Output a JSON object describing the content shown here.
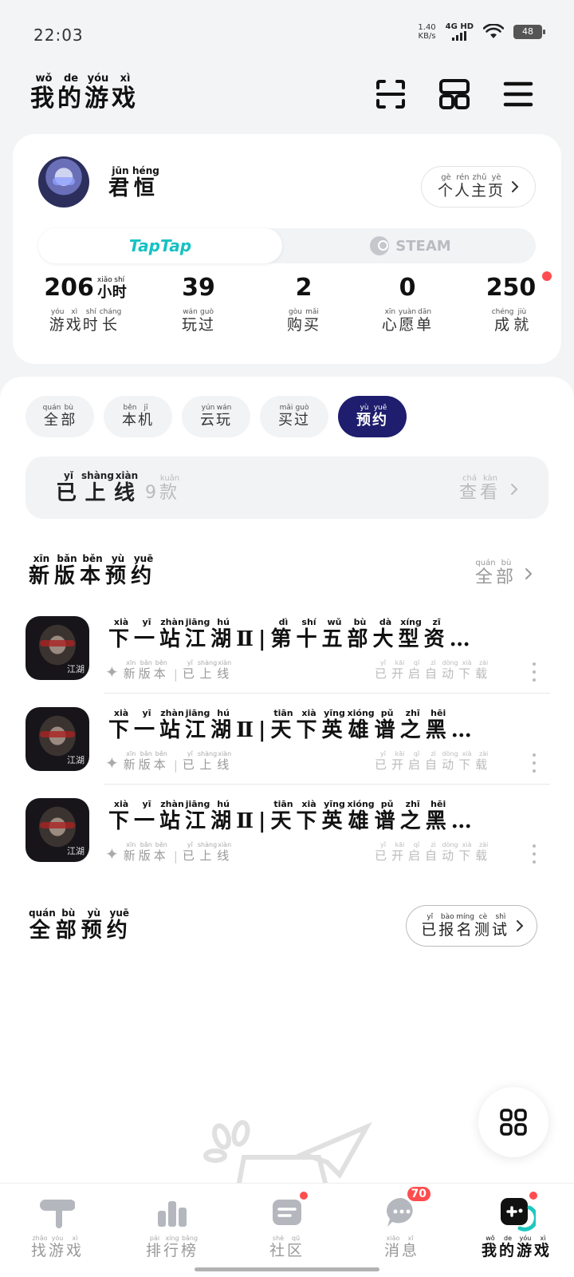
{
  "status_bar": {
    "time": "22:03",
    "net_speed_value": "1.40",
    "net_speed_unit": "KB/s",
    "network": "4G HD",
    "battery": "48"
  },
  "header": {
    "title": [
      "我",
      "的",
      "游",
      "戏"
    ],
    "title_pinyin": [
      "wǒ",
      "de",
      "yóu",
      "xì"
    ],
    "icons": [
      "scan-icon",
      "layout-grid-icon",
      "menu-icon"
    ]
  },
  "profile": {
    "name": [
      "君",
      "恒"
    ],
    "name_pinyin": [
      "jūn",
      "héng"
    ],
    "homepage": [
      "个",
      "人",
      "主",
      "页"
    ],
    "homepage_pinyin": [
      "gè",
      "rén",
      "zhǔ",
      "yè"
    ],
    "platforms": {
      "active": "TapTap",
      "inactive": "STEAM"
    },
    "stats": [
      {
        "value": "206",
        "unit": [
          "小",
          "时"
        ],
        "unit_pinyin": [
          "xiǎo",
          "shí"
        ],
        "label": [
          "游",
          "戏",
          "时",
          "长"
        ],
        "label_pinyin": [
          "yóu",
          "xì",
          "shí",
          "cháng"
        ]
      },
      {
        "value": "39",
        "label": [
          "玩",
          "过"
        ],
        "label_pinyin": [
          "wán",
          "guò"
        ]
      },
      {
        "value": "2",
        "label": [
          "购",
          "买"
        ],
        "label_pinyin": [
          "gòu",
          "mǎi"
        ]
      },
      {
        "value": "0",
        "label": [
          "心",
          "愿",
          "单"
        ],
        "label_pinyin": [
          "xīn",
          "yuàn",
          "dān"
        ]
      },
      {
        "value": "250",
        "label": [
          "成",
          "就"
        ],
        "label_pinyin": [
          "chéng",
          "jiù"
        ],
        "has_dot": true
      }
    ]
  },
  "filters": [
    {
      "label": [
        "全",
        "部"
      ],
      "pinyin": [
        "quán",
        "bù"
      ],
      "active": false
    },
    {
      "label": [
        "本",
        "机"
      ],
      "pinyin": [
        "běn",
        "jī"
      ],
      "active": false
    },
    {
      "label": [
        "云",
        "玩"
      ],
      "pinyin": [
        "yún",
        "wán"
      ],
      "active": false
    },
    {
      "label": [
        "买",
        "过"
      ],
      "pinyin": [
        "mǎi",
        "guò"
      ],
      "active": false
    },
    {
      "label": [
        "预",
        "约"
      ],
      "pinyin": [
        "yù",
        "yuē"
      ],
      "active": true
    }
  ],
  "online": {
    "label": [
      "已",
      "上",
      "线"
    ],
    "label_pinyin": [
      "yǐ",
      "shàng",
      "xiàn"
    ],
    "count": [
      "9",
      "款"
    ],
    "count_pinyin": [
      "",
      "kuǎn"
    ],
    "view": [
      "查",
      "看"
    ],
    "view_pinyin": [
      "chá",
      "kàn"
    ]
  },
  "new_version_section": {
    "title": [
      "新",
      "版",
      "本",
      "预",
      "约"
    ],
    "title_pinyin": [
      "xīn",
      "bǎn",
      "běn",
      "yù",
      "yuē"
    ],
    "all": [
      "全",
      "部"
    ],
    "all_pinyin": [
      "quán",
      "bù"
    ]
  },
  "games": [
    {
      "title_chars": [
        "下",
        "一",
        "站",
        "江",
        "湖",
        "Ⅱ",
        "|",
        "第",
        "十",
        "五",
        "部",
        "大",
        "型",
        "资",
        "…"
      ],
      "title_pinyin": [
        "xià",
        "yī",
        "zhàn",
        "jiāng",
        "hú",
        "",
        "",
        "dì",
        "shí",
        "wǔ",
        "bù",
        "dà",
        "xíng",
        "zī",
        ""
      ],
      "tag": [
        "新",
        "版",
        "本"
      ],
      "tag_pinyin": [
        "xīn",
        "bǎn",
        "běn"
      ],
      "status": [
        "已",
        "上",
        "线"
      ],
      "status_pinyin": [
        "yǐ",
        "shàng",
        "xiàn"
      ],
      "extra": [
        "已",
        "开",
        "启",
        "自",
        "动",
        "下",
        "载"
      ],
      "extra_pinyin": [
        "yǐ",
        "kāi",
        "qǐ",
        "zì",
        "dòng",
        "xià",
        "zài"
      ],
      "icon_text": "江湖"
    },
    {
      "title_chars": [
        "下",
        "一",
        "站",
        "江",
        "湖",
        "Ⅱ",
        "|",
        "天",
        "下",
        "英",
        "雄",
        "谱",
        "之",
        "黑",
        "…"
      ],
      "title_pinyin": [
        "xià",
        "yī",
        "zhàn",
        "jiāng",
        "hú",
        "",
        "",
        "tiān",
        "xià",
        "yīng",
        "xióng",
        "pǔ",
        "zhī",
        "hēi",
        ""
      ],
      "tag": [
        "新",
        "版",
        "本"
      ],
      "tag_pinyin": [
        "xīn",
        "bǎn",
        "běn"
      ],
      "status": [
        "已",
        "上",
        "线"
      ],
      "status_pinyin": [
        "yǐ",
        "shàng",
        "xiàn"
      ],
      "extra": [
        "已",
        "开",
        "启",
        "自",
        "动",
        "下",
        "载"
      ],
      "extra_pinyin": [
        "yǐ",
        "kāi",
        "qǐ",
        "zì",
        "dòng",
        "xià",
        "zài"
      ],
      "icon_text": "江湖"
    },
    {
      "title_chars": [
        "下",
        "一",
        "站",
        "江",
        "湖",
        "Ⅱ",
        "|",
        "天",
        "下",
        "英",
        "雄",
        "谱",
        "之",
        "黑",
        "…"
      ],
      "title_pinyin": [
        "xià",
        "yī",
        "zhàn",
        "jiāng",
        "hú",
        "",
        "",
        "tiān",
        "xià",
        "yīng",
        "xióng",
        "pǔ",
        "zhī",
        "hēi",
        ""
      ],
      "tag": [
        "新",
        "版",
        "本"
      ],
      "tag_pinyin": [
        "xīn",
        "bǎn",
        "běn"
      ],
      "status": [
        "已",
        "上",
        "线"
      ],
      "status_pinyin": [
        "yǐ",
        "shàng",
        "xiàn"
      ],
      "extra": [
        "已",
        "开",
        "启",
        "自",
        "动",
        "下",
        "载"
      ],
      "extra_pinyin": [
        "yǐ",
        "kāi",
        "qǐ",
        "zì",
        "dòng",
        "xià",
        "zài"
      ],
      "icon_text": "江湖"
    }
  ],
  "all_reservations": {
    "title": [
      "全",
      "部",
      "预",
      "约"
    ],
    "title_pinyin": [
      "quán",
      "bù",
      "yù",
      "yuē"
    ],
    "button": [
      "已",
      "报",
      "名",
      "测",
      "试"
    ],
    "button_pinyin": [
      "yǐ",
      "bào",
      "míng",
      "cè",
      "shì"
    ]
  },
  "bottom_nav": [
    {
      "label": [
        "找",
        "游",
        "戏"
      ],
      "pinyin": [
        "zhǎo",
        "yóu",
        "xì"
      ],
      "icon": "find-game-icon",
      "active": false
    },
    {
      "label": [
        "排",
        "行",
        "榜"
      ],
      "pinyin": [
        "pái",
        "xíng",
        "bǎng"
      ],
      "icon": "ranking-icon",
      "active": false
    },
    {
      "label": [
        "社",
        "区"
      ],
      "pinyin": [
        "shè",
        "qū"
      ],
      "icon": "community-icon",
      "active": false,
      "dot": true
    },
    {
      "label": [
        "消",
        "息"
      ],
      "pinyin": [
        "xiāo",
        "xī"
      ],
      "icon": "message-icon",
      "active": false,
      "badge": "70"
    },
    {
      "label": [
        "我",
        "的",
        "游",
        "戏"
      ],
      "pinyin": [
        "wǒ",
        "de",
        "yóu",
        "xì"
      ],
      "icon": "my-games-icon",
      "active": true,
      "dot": true
    }
  ],
  "colors": {
    "accent": "#1f1d6e",
    "taptap": "#16c2c2",
    "badge": "#ff4d4f",
    "background": "#f3f4f6"
  }
}
